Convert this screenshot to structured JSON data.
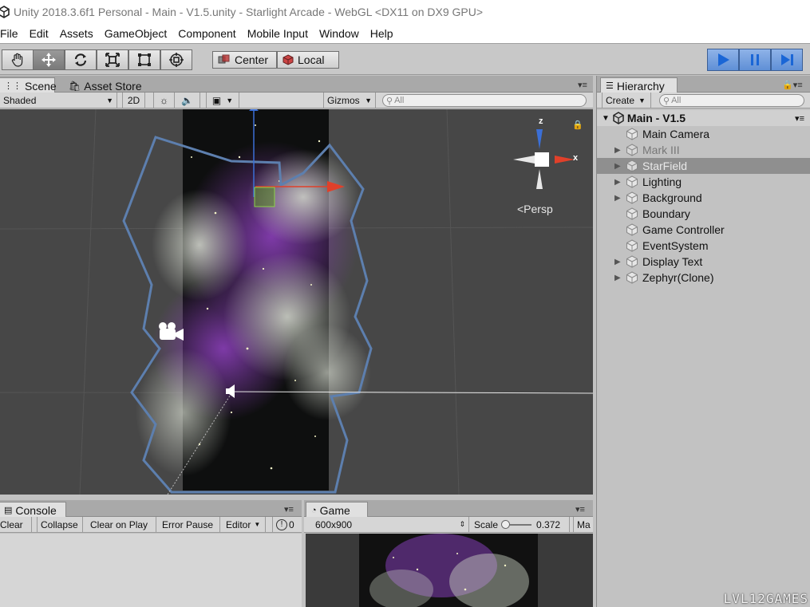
{
  "window": {
    "title": "Unity 2018.3.6f1 Personal - Main - V1.5.unity - Starlight Arcade - WebGL <DX11 on DX9 GPU>"
  },
  "menu": [
    "File",
    "Edit",
    "Assets",
    "GameObject",
    "Component",
    "Mobile Input",
    "Window",
    "Help"
  ],
  "toolbar": {
    "tools": [
      "hand-tool",
      "move-tool",
      "rotate-tool",
      "scale-tool",
      "rect-tool",
      "transform-tool"
    ],
    "pivot_mode": "Center",
    "pivot_rotation": "Local"
  },
  "scene_panel": {
    "tabs": [
      "Scene",
      "Asset Store"
    ],
    "shading": "Shaded",
    "mode_2d": "2D",
    "gizmos": "Gizmos",
    "search_placeholder": "All",
    "persp_label": "<Persp",
    "axis_z": "z",
    "axis_x": "x"
  },
  "hierarchy": {
    "tab": "Hierarchy",
    "create": "Create",
    "search_placeholder": "All",
    "scene_name": "Main - V1.5",
    "items": [
      {
        "label": "Main Camera",
        "expandable": false,
        "dim": false,
        "selected": false
      },
      {
        "label": "Mark III",
        "expandable": true,
        "dim": true,
        "selected": false
      },
      {
        "label": "StarField",
        "expandable": true,
        "dim": true,
        "selected": true
      },
      {
        "label": "Lighting",
        "expandable": true,
        "dim": false,
        "selected": false
      },
      {
        "label": "Background",
        "expandable": true,
        "dim": false,
        "selected": false
      },
      {
        "label": "Boundary",
        "expandable": false,
        "dim": false,
        "selected": false
      },
      {
        "label": "Game Controller",
        "expandable": false,
        "dim": false,
        "selected": false
      },
      {
        "label": "EventSystem",
        "expandable": false,
        "dim": false,
        "selected": false
      },
      {
        "label": "Display Text",
        "expandable": true,
        "dim": false,
        "selected": false
      },
      {
        "label": "Zephyr(Clone)",
        "expandable": true,
        "dim": false,
        "selected": false
      }
    ]
  },
  "console_panel": {
    "tab": "Console",
    "buttons": [
      "Clear",
      "Collapse",
      "Clear on Play",
      "Error Pause",
      "Editor"
    ],
    "error_count": "0"
  },
  "game_panel": {
    "tab": "Game",
    "resolution": "600x900",
    "scale_label": "Scale",
    "scale_value": "0.372",
    "maximize": "Ma"
  },
  "watermark": "LVL12GAMES",
  "colors": {
    "play_accent": "#5f8fd6",
    "selection": "#8f8f8f",
    "boundary_blue": "#5d7fae"
  }
}
